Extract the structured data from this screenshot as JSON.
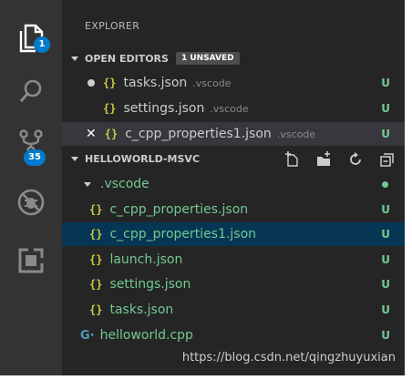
{
  "activity_bar": {
    "explorer_badge": "1",
    "scm_badge": "35"
  },
  "explorer": {
    "title": "EXPLORER",
    "open_editors": {
      "header": "OPEN EDITORS",
      "badge": "1 UNSAVED",
      "items": [
        {
          "name": "tasks.json",
          "dir": ".vscode",
          "status": "U"
        },
        {
          "name": "settings.json",
          "dir": ".vscode",
          "status": "U"
        },
        {
          "name": "c_cpp_properties1.json",
          "dir": ".vscode",
          "status": "U"
        }
      ]
    },
    "workspace": {
      "header": "HELLOWORLD-MSVC",
      "folder": ".vscode",
      "items": [
        {
          "name": "c_cpp_properties.json",
          "status": "U"
        },
        {
          "name": "c_cpp_properties1.json",
          "status": "U"
        },
        {
          "name": "launch.json",
          "status": "U"
        },
        {
          "name": "settings.json",
          "status": "U"
        },
        {
          "name": "tasks.json",
          "status": "U"
        },
        {
          "name": "helloworld.cpp",
          "status": "U"
        }
      ]
    }
  },
  "watermark": "https://blog.csdn.net/qingzhuyuxian",
  "colors": {
    "accent": "#007acc",
    "untracked": "#73c991",
    "json_icon": "#cbcb41",
    "selected_row": "#073655"
  }
}
